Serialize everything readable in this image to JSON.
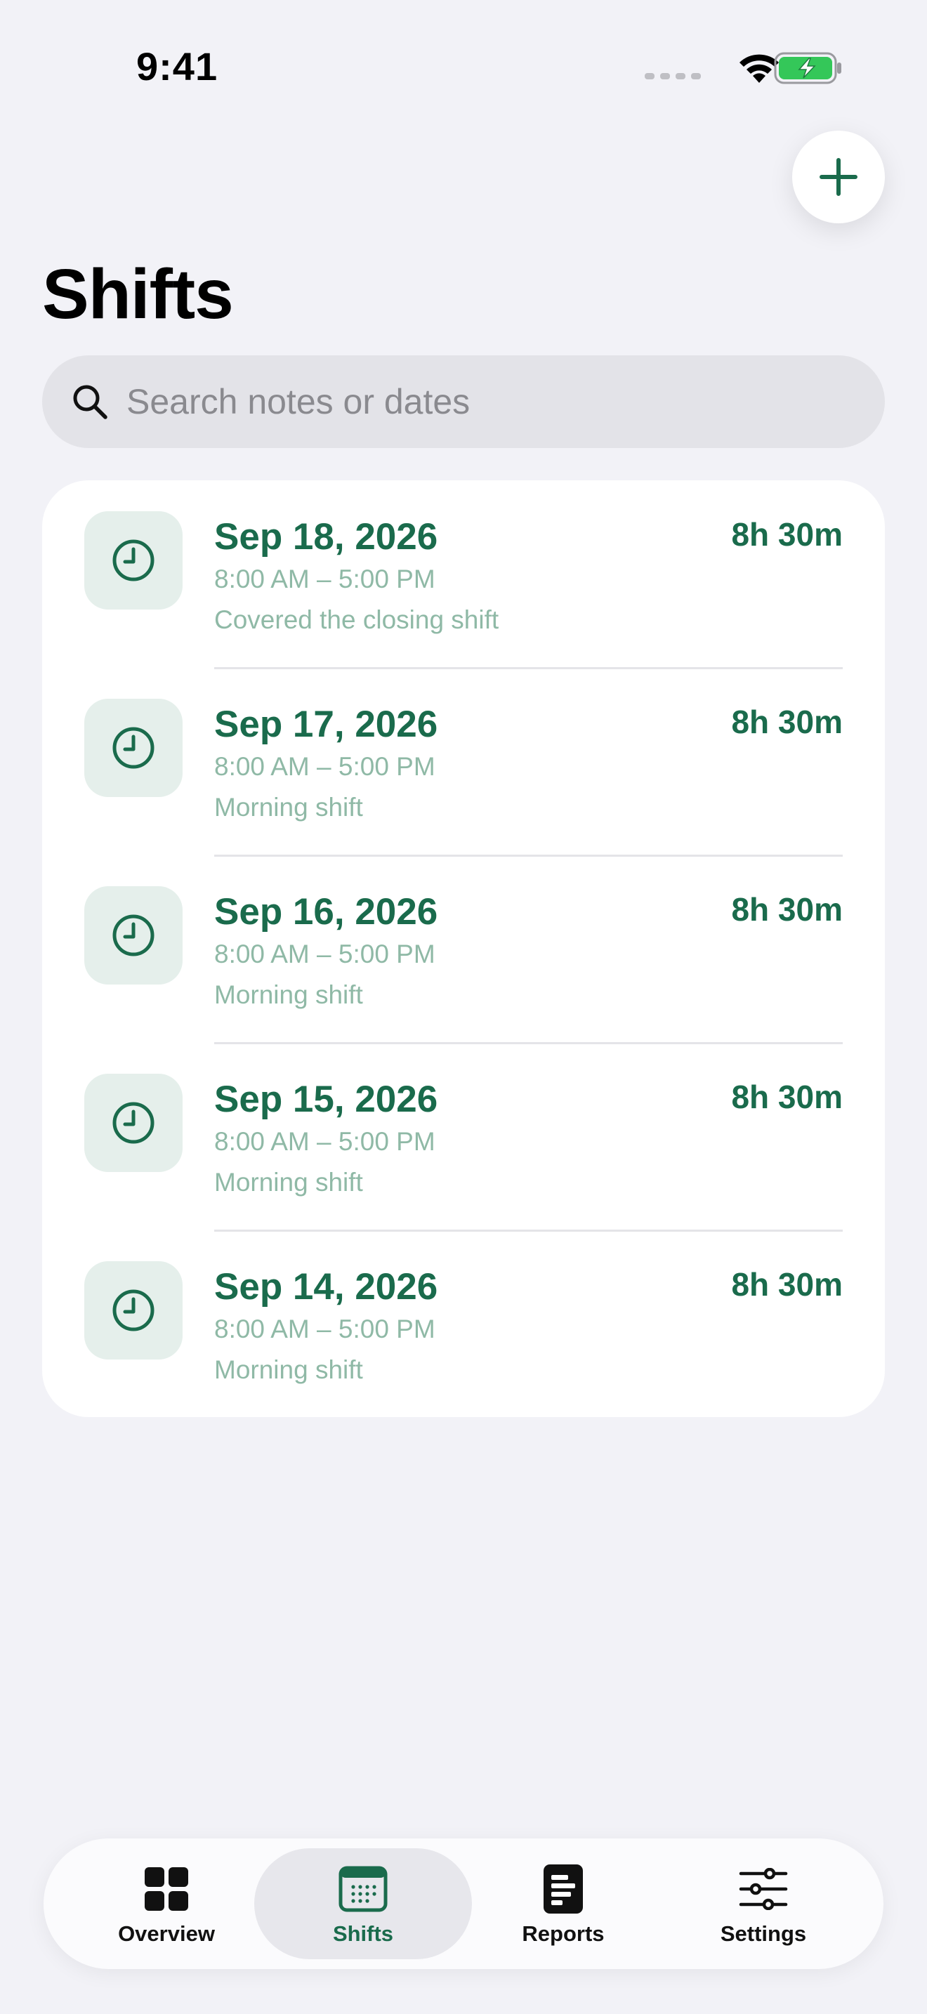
{
  "status_bar": {
    "time": "9:41"
  },
  "header": {
    "title": "Shifts",
    "add_button_icon": "plus-icon"
  },
  "search": {
    "placeholder": "Search notes or dates",
    "value": ""
  },
  "shifts": [
    {
      "date": "Sep 18, 2026",
      "time_range": "8:00 AM – 5:00 PM",
      "note": "Covered the closing shift",
      "duration": "8h 30m"
    },
    {
      "date": "Sep 17, 2026",
      "time_range": "8:00 AM – 5:00 PM",
      "note": "Morning shift",
      "duration": "8h 30m"
    },
    {
      "date": "Sep 16, 2026",
      "time_range": "8:00 AM – 5:00 PM",
      "note": "Morning shift",
      "duration": "8h 30m"
    },
    {
      "date": "Sep 15, 2026",
      "time_range": "8:00 AM – 5:00 PM",
      "note": "Morning shift",
      "duration": "8h 30m"
    },
    {
      "date": "Sep 14, 2026",
      "time_range": "8:00 AM – 5:00 PM",
      "note": "Morning shift",
      "duration": "8h 30m"
    }
  ],
  "tab_bar": {
    "active": "Shifts",
    "tabs": [
      {
        "label": "Overview",
        "icon": "grid-icon"
      },
      {
        "label": "Shifts",
        "icon": "calendar-icon"
      },
      {
        "label": "Reports",
        "icon": "report-icon"
      },
      {
        "label": "Settings",
        "icon": "sliders-icon"
      }
    ]
  },
  "colors": {
    "accent": "#1a6b4c",
    "secondary_text": "#8fb9a6",
    "background": "#f2f2f7",
    "battery_green": "#34c759"
  }
}
